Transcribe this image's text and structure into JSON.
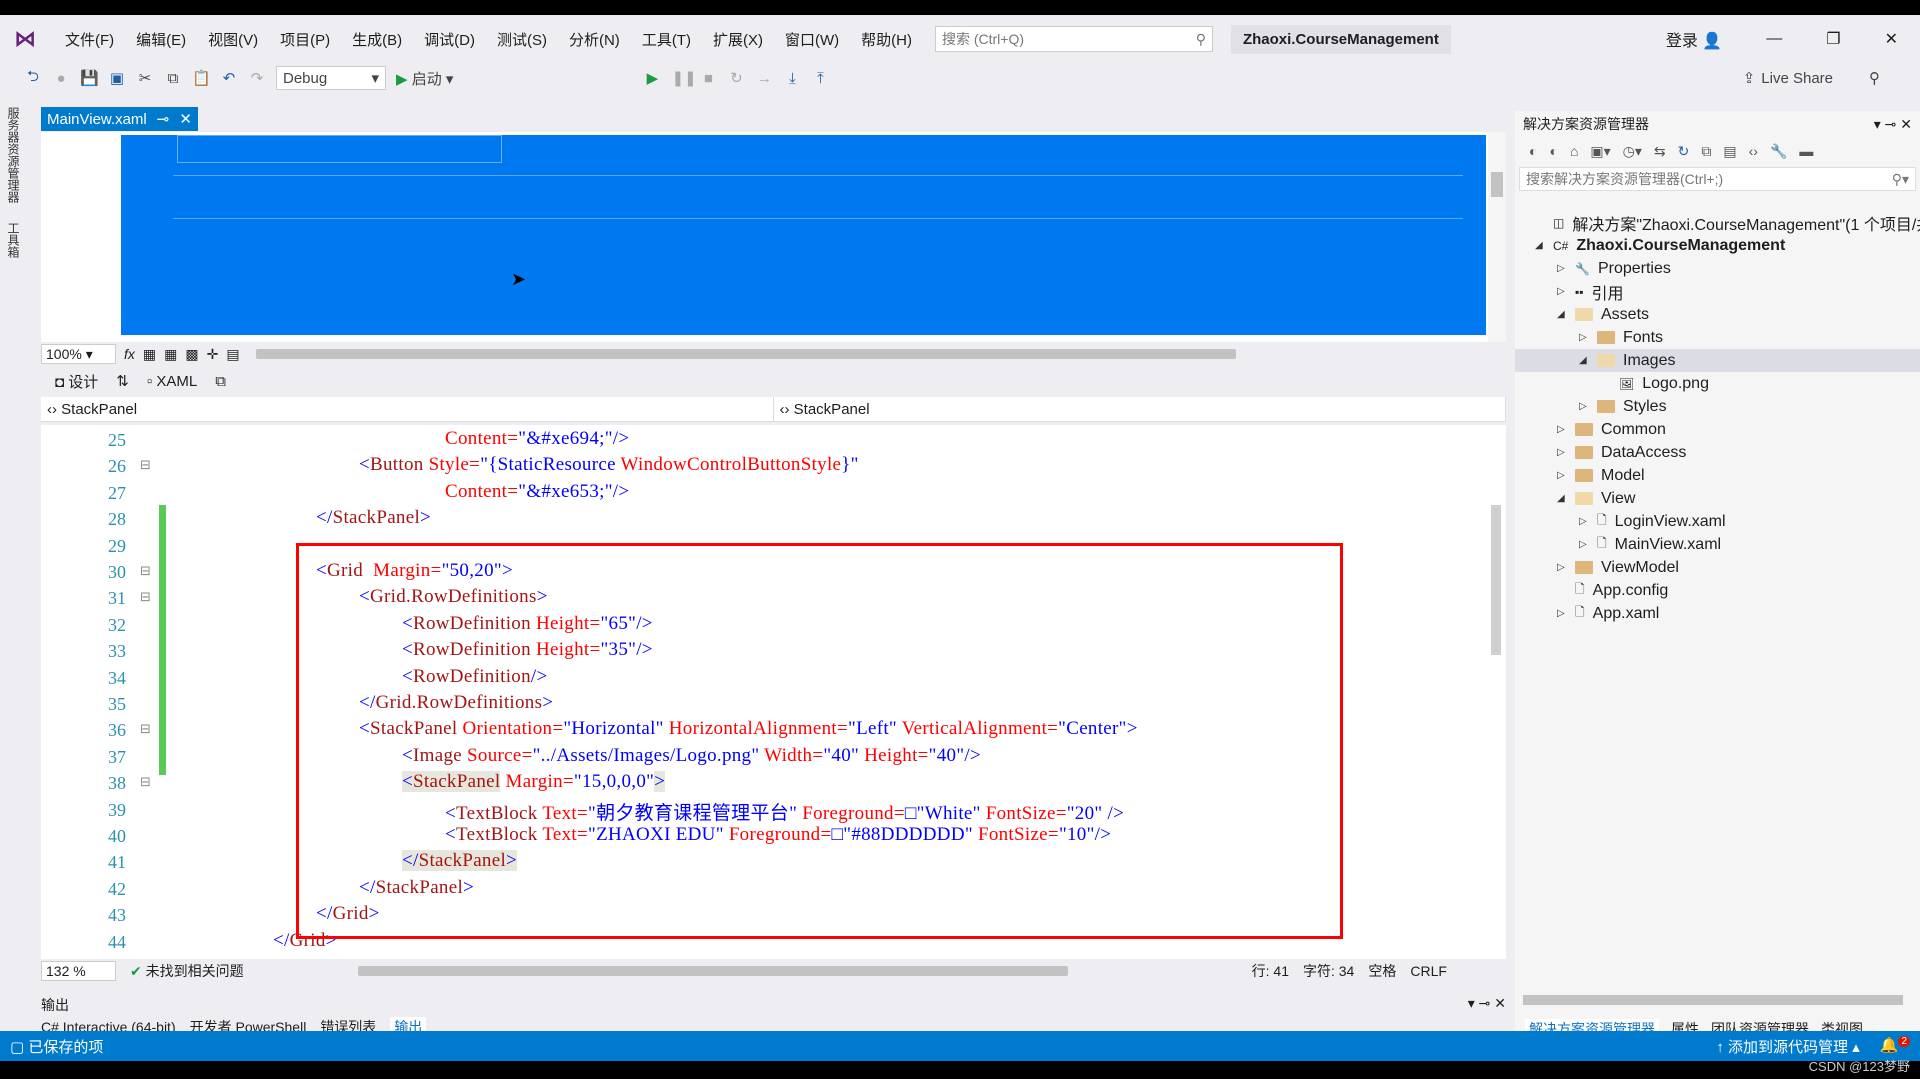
{
  "menubar": {
    "items": [
      "文件(F)",
      "编辑(E)",
      "视图(V)",
      "项目(P)",
      "生成(B)",
      "调试(D)",
      "测试(S)",
      "分析(N)",
      "工具(T)",
      "扩展(X)",
      "窗口(W)",
      "帮助(H)"
    ],
    "search_placeholder": "搜索 (Ctrl+Q)",
    "project_title": "Zhaoxi.CourseManagement",
    "login": "登录"
  },
  "toolbar": {
    "config": "Debug",
    "start": "启动",
    "live_share": "Live Share"
  },
  "side_strip": {
    "server_explorer": "服务器资源管理器",
    "toolbox": "工具箱"
  },
  "document_tab": {
    "label": "MainView.xaml"
  },
  "designer": {
    "zoom": "100%",
    "design_tab": "设计",
    "xaml_tab": "XAML"
  },
  "navbar": {
    "left": "StackPanel",
    "right": "StackPanel"
  },
  "code": [
    {
      "n": "25",
      "i": 3,
      "t": [
        [
          "attr",
          "Content="
        ],
        [
          "val",
          "\"&#xe694;\""
        ],
        [
          "pun",
          "/>"
        ]
      ]
    },
    {
      "n": "26",
      "i": 1,
      "t": [
        [
          "pun",
          "<"
        ],
        [
          "tag",
          "Button "
        ],
        [
          "attr",
          "Style="
        ],
        [
          "val",
          "\"{StaticResource "
        ],
        [
          "attr",
          "WindowControlButtonStyle"
        ],
        [
          "val",
          "}\""
        ]
      ]
    },
    {
      "n": "27",
      "i": 3,
      "t": [
        [
          "attr",
          "Content="
        ],
        [
          "val",
          "\"&#xe653;\""
        ],
        [
          "pun",
          "/>"
        ]
      ]
    },
    {
      "n": "28",
      "i": 0,
      "t": [
        [
          "pun",
          "</"
        ],
        [
          "tag",
          "StackPanel"
        ],
        [
          "pun",
          ">"
        ]
      ]
    },
    {
      "n": "29",
      "i": 0,
      "t": []
    },
    {
      "n": "30",
      "i": 0,
      "t": [
        [
          "pun",
          "<"
        ],
        [
          "tag",
          "Grid  "
        ],
        [
          "attr",
          "Margin="
        ],
        [
          "val",
          "\"50,20\""
        ],
        [
          "pun",
          ">"
        ]
      ]
    },
    {
      "n": "31",
      "i": 1,
      "t": [
        [
          "pun",
          "<"
        ],
        [
          "tag",
          "Grid.RowDefinitions"
        ],
        [
          "pun",
          ">"
        ]
      ]
    },
    {
      "n": "32",
      "i": 2,
      "t": [
        [
          "pun",
          "<"
        ],
        [
          "tag",
          "RowDefinition "
        ],
        [
          "attr",
          "Height="
        ],
        [
          "val",
          "\"65\""
        ],
        [
          "pun",
          "/>"
        ]
      ]
    },
    {
      "n": "33",
      "i": 2,
      "t": [
        [
          "pun",
          "<"
        ],
        [
          "tag",
          "RowDefinition "
        ],
        [
          "attr",
          "Height="
        ],
        [
          "val",
          "\"35\""
        ],
        [
          "pun",
          "/>"
        ]
      ]
    },
    {
      "n": "34",
      "i": 2,
      "t": [
        [
          "pun",
          "<"
        ],
        [
          "tag",
          "RowDefinition"
        ],
        [
          "pun",
          "/>"
        ]
      ]
    },
    {
      "n": "35",
      "i": 1,
      "t": [
        [
          "pun",
          "</"
        ],
        [
          "tag",
          "Grid.RowDefinitions"
        ],
        [
          "pun",
          ">"
        ]
      ]
    },
    {
      "n": "36",
      "i": 1,
      "t": [
        [
          "pun",
          "<"
        ],
        [
          "tag",
          "StackPanel "
        ],
        [
          "attr",
          "Orientation="
        ],
        [
          "val",
          "\"Horizontal\" "
        ],
        [
          "attr",
          "HorizontalAlignment="
        ],
        [
          "val",
          "\"Left\" "
        ],
        [
          "attr",
          "VerticalAlignment="
        ],
        [
          "val",
          "\"Center\""
        ],
        [
          "pun",
          ">"
        ]
      ]
    },
    {
      "n": "37",
      "i": 2,
      "t": [
        [
          "pun",
          "<"
        ],
        [
          "tag",
          "Image "
        ],
        [
          "attr",
          "Source="
        ],
        [
          "val",
          "\"../Assets/Images/Logo.png\" "
        ],
        [
          "attr",
          "Width="
        ],
        [
          "val",
          "\"40\" "
        ],
        [
          "attr",
          "Height="
        ],
        [
          "val",
          "\"40\""
        ],
        [
          "pun",
          "/>"
        ]
      ]
    },
    {
      "n": "38",
      "i": 2,
      "t": [
        [
          "pun hl",
          "<"
        ],
        [
          "tag hl",
          "StackPanel"
        ],
        [
          "attr",
          " Margin="
        ],
        [
          "val",
          "\"15,0,0,0\""
        ],
        [
          "pun hl",
          ">"
        ]
      ]
    },
    {
      "n": "39",
      "i": 3,
      "t": [
        [
          "pun",
          "<"
        ],
        [
          "tag",
          "TextBlock "
        ],
        [
          "attr",
          "Text="
        ],
        [
          "val",
          "\"朝夕教育课程管理平台\" "
        ],
        [
          "attr",
          "Foreground="
        ],
        [
          "val",
          "□\"White\" "
        ],
        [
          "attr",
          "FontSize="
        ],
        [
          "val",
          "\"20\" "
        ],
        [
          "pun",
          "/>"
        ]
      ]
    },
    {
      "n": "40",
      "i": 3,
      "t": [
        [
          "pun",
          "<"
        ],
        [
          "tag",
          "TextBlock "
        ],
        [
          "attr",
          "Text="
        ],
        [
          "val",
          "\"ZHAOXI EDU\" "
        ],
        [
          "attr",
          "Foreground="
        ],
        [
          "val",
          "□\"#88DDDDDD\" "
        ],
        [
          "attr",
          "FontSize="
        ],
        [
          "val",
          "\"10\""
        ],
        [
          "pun",
          "/>"
        ]
      ]
    },
    {
      "n": "41",
      "i": 2,
      "t": [
        [
          "pun hl",
          "</"
        ],
        [
          "tag hl",
          "StackPanel"
        ],
        [
          "pun hl",
          ">"
        ]
      ]
    },
    {
      "n": "42",
      "i": 1,
      "t": [
        [
          "pun",
          "</"
        ],
        [
          "tag",
          "StackPanel"
        ],
        [
          "pun",
          ">"
        ]
      ]
    },
    {
      "n": "43",
      "i": 0,
      "t": [
        [
          "pun",
          "</"
        ],
        [
          "tag",
          "Grid"
        ],
        [
          "pun",
          ">"
        ]
      ]
    },
    {
      "n": "44",
      "i": -1,
      "t": [
        [
          "pun",
          "</"
        ],
        [
          "tag",
          "Grid"
        ],
        [
          "pun",
          ">"
        ]
      ]
    }
  ],
  "editor_status": {
    "zoom": "132 %",
    "issues": "未找到相关问题",
    "line": "行: 41",
    "char": "字符: 34",
    "spaces": "空格",
    "eol": "CRLF"
  },
  "output": {
    "title": "输出",
    "tabs": [
      "C# Interactive (64-bit)",
      "开发者 PowerShell",
      "错误列表",
      "输出"
    ]
  },
  "statusbar": {
    "left": "已保存的项",
    "source_control": "添加到源代码管理",
    "notifications": "2"
  },
  "solution_explorer": {
    "title": "解决方案资源管理器",
    "search_placeholder": "搜索解决方案资源管理器(Ctrl+;)",
    "items": [
      {
        "label": "解决方案\"Zhaoxi.CourseManagement\"(1 个项目/共",
        "level": 0,
        "icon": "solution-icon",
        "exp": ""
      },
      {
        "label": "Zhaoxi.CourseManagement",
        "level": 0,
        "icon": "csharp-project-icon",
        "exp": "open",
        "bold": true
      },
      {
        "label": "Properties",
        "level": 1,
        "icon": "wrench-icon",
        "exp": "closed"
      },
      {
        "label": "引用",
        "level": 1,
        "icon": "references-icon",
        "exp": "closed"
      },
      {
        "label": "Assets",
        "level": 1,
        "icon": "folder-open-icon",
        "exp": "open"
      },
      {
        "label": "Fonts",
        "level": 2,
        "icon": "folder-icon",
        "exp": "closed"
      },
      {
        "label": "Images",
        "level": 2,
        "icon": "folder-open-icon",
        "exp": "open",
        "selected": true
      },
      {
        "label": "Logo.png",
        "level": 3,
        "icon": "image-file-icon",
        "exp": ""
      },
      {
        "label": "Styles",
        "level": 2,
        "icon": "folder-icon",
        "exp": "closed"
      },
      {
        "label": "Common",
        "level": 1,
        "icon": "folder-icon",
        "exp": "closed"
      },
      {
        "label": "DataAccess",
        "level": 1,
        "icon": "folder-icon",
        "exp": "closed"
      },
      {
        "label": "Model",
        "level": 1,
        "icon": "folder-icon",
        "exp": "closed"
      },
      {
        "label": "View",
        "level": 1,
        "icon": "folder-open-icon",
        "exp": "open"
      },
      {
        "label": "LoginView.xaml",
        "level": 2,
        "icon": "xaml-file-icon",
        "exp": "closed"
      },
      {
        "label": "MainView.xaml",
        "level": 2,
        "icon": "xaml-file-icon",
        "exp": "closed"
      },
      {
        "label": "ViewModel",
        "level": 1,
        "icon": "folder-icon",
        "exp": "closed"
      },
      {
        "label": "App.config",
        "level": 1,
        "icon": "config-file-icon",
        "exp": ""
      },
      {
        "label": "App.xaml",
        "level": 1,
        "icon": "xaml-file-icon",
        "exp": "closed"
      }
    ],
    "bottom_tabs": [
      "解决方案资源管理器",
      "属性",
      "团队资源管理器",
      "类视图"
    ]
  },
  "watermark": "CSDN @123梦野",
  "colors": {
    "accent": "#007acc",
    "designer_bg": "#0078f0",
    "highlight_box": "#ff0000"
  }
}
